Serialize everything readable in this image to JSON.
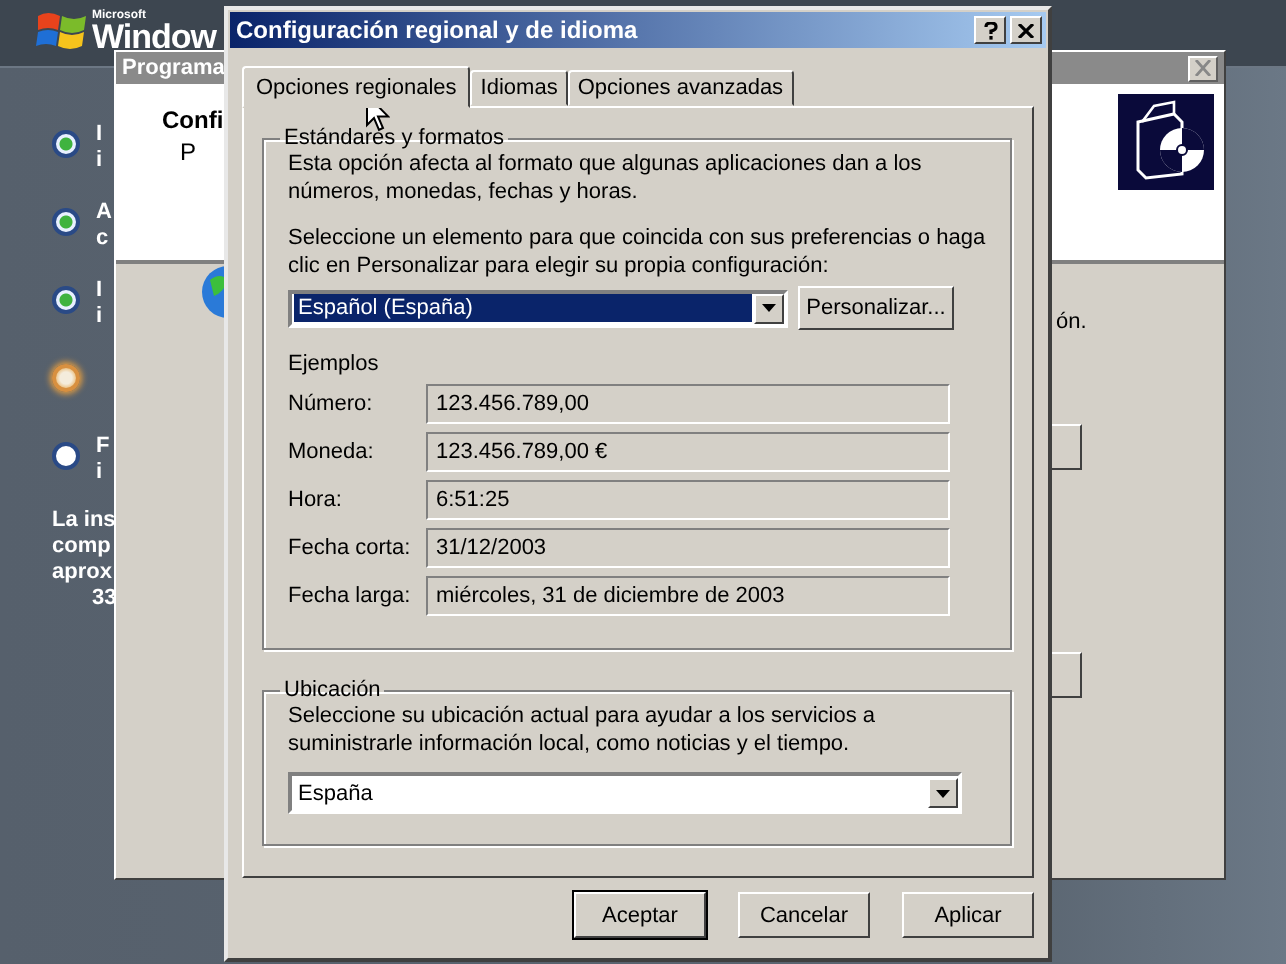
{
  "setup_screen": {
    "logo": {
      "maker": "Microsoft",
      "product": "Window"
    },
    "steps": [
      {
        "completed": true,
        "current": false,
        "lines": [
          "I",
          "i"
        ]
      },
      {
        "completed": true,
        "current": false,
        "lines": [
          "A",
          "c"
        ]
      },
      {
        "completed": true,
        "current": false,
        "lines": [
          "I",
          "i"
        ]
      },
      {
        "completed": false,
        "current": true
      },
      {
        "completed": false,
        "current": false,
        "lines": [
          "F",
          "i"
        ]
      }
    ],
    "time_note": [
      "La ins",
      "comp",
      "aprox",
      "33"
    ]
  },
  "background_window": {
    "title": "Programa",
    "header_title": "Confi",
    "header_subtitle": "P",
    "side_text": "ón."
  },
  "dialog": {
    "title": "Configuración regional y de idioma",
    "tabs": [
      {
        "label": "Opciones regionales",
        "selected": true
      },
      {
        "label": "Idiomas",
        "selected": false
      },
      {
        "label": "Opciones avanzadas",
        "selected": false
      }
    ],
    "standards": {
      "legend": "Estándares y formatos",
      "description": "Esta opción afecta al formato que algunas aplicaciones dan a los números, monedas, fechas y horas.",
      "instruction": "Seleccione un elemento para que coincida con sus preferencias o haga clic en Personalizar para elegir su propia configuración:",
      "format": "Español (España)",
      "customize_button": "Personalizar...",
      "examples_heading": "Ejemplos",
      "examples": [
        {
          "label": "Número:",
          "value": "123.456.789,00"
        },
        {
          "label": "Moneda:",
          "value": "123.456.789,00 €"
        },
        {
          "label": "Hora:",
          "value": "6:51:25"
        },
        {
          "label": "Fecha corta:",
          "value": "31/12/2003"
        },
        {
          "label": "Fecha larga:",
          "value": "miércoles, 31 de diciembre de 2003"
        }
      ]
    },
    "location": {
      "legend": "Ubicación",
      "description": "Seleccione su ubicación actual para ayudar a los servicios a suministrarle información local, como noticias y el tiempo.",
      "country": "España"
    },
    "buttons": [
      {
        "label": "Aceptar",
        "default": true
      },
      {
        "label": "Cancelar",
        "default": false
      },
      {
        "label": "Aplicar",
        "default": false
      }
    ]
  }
}
